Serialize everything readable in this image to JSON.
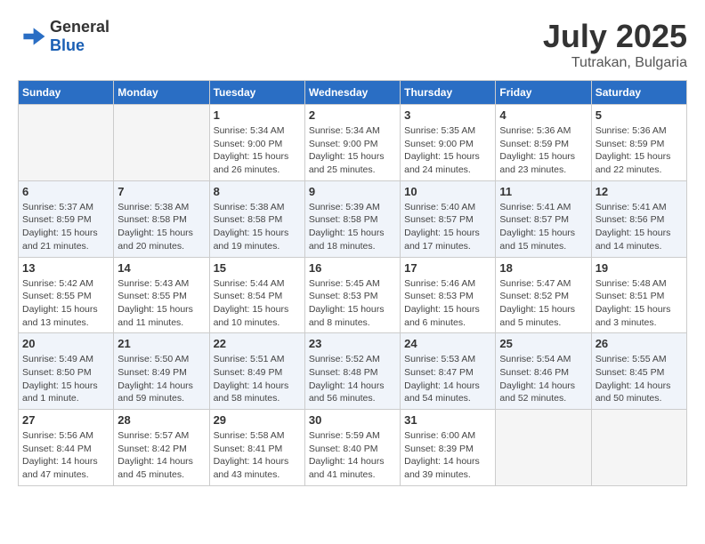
{
  "header": {
    "logo_general": "General",
    "logo_blue": "Blue",
    "month_year": "July 2025",
    "location": "Tutrakan, Bulgaria"
  },
  "weekdays": [
    "Sunday",
    "Monday",
    "Tuesday",
    "Wednesday",
    "Thursday",
    "Friday",
    "Saturday"
  ],
  "weeks": [
    [
      {
        "day": "",
        "info": ""
      },
      {
        "day": "",
        "info": ""
      },
      {
        "day": "1",
        "info": "Sunrise: 5:34 AM\nSunset: 9:00 PM\nDaylight: 15 hours\nand 26 minutes."
      },
      {
        "day": "2",
        "info": "Sunrise: 5:34 AM\nSunset: 9:00 PM\nDaylight: 15 hours\nand 25 minutes."
      },
      {
        "day": "3",
        "info": "Sunrise: 5:35 AM\nSunset: 9:00 PM\nDaylight: 15 hours\nand 24 minutes."
      },
      {
        "day": "4",
        "info": "Sunrise: 5:36 AM\nSunset: 8:59 PM\nDaylight: 15 hours\nand 23 minutes."
      },
      {
        "day": "5",
        "info": "Sunrise: 5:36 AM\nSunset: 8:59 PM\nDaylight: 15 hours\nand 22 minutes."
      }
    ],
    [
      {
        "day": "6",
        "info": "Sunrise: 5:37 AM\nSunset: 8:59 PM\nDaylight: 15 hours\nand 21 minutes."
      },
      {
        "day": "7",
        "info": "Sunrise: 5:38 AM\nSunset: 8:58 PM\nDaylight: 15 hours\nand 20 minutes."
      },
      {
        "day": "8",
        "info": "Sunrise: 5:38 AM\nSunset: 8:58 PM\nDaylight: 15 hours\nand 19 minutes."
      },
      {
        "day": "9",
        "info": "Sunrise: 5:39 AM\nSunset: 8:58 PM\nDaylight: 15 hours\nand 18 minutes."
      },
      {
        "day": "10",
        "info": "Sunrise: 5:40 AM\nSunset: 8:57 PM\nDaylight: 15 hours\nand 17 minutes."
      },
      {
        "day": "11",
        "info": "Sunrise: 5:41 AM\nSunset: 8:57 PM\nDaylight: 15 hours\nand 15 minutes."
      },
      {
        "day": "12",
        "info": "Sunrise: 5:41 AM\nSunset: 8:56 PM\nDaylight: 15 hours\nand 14 minutes."
      }
    ],
    [
      {
        "day": "13",
        "info": "Sunrise: 5:42 AM\nSunset: 8:55 PM\nDaylight: 15 hours\nand 13 minutes."
      },
      {
        "day": "14",
        "info": "Sunrise: 5:43 AM\nSunset: 8:55 PM\nDaylight: 15 hours\nand 11 minutes."
      },
      {
        "day": "15",
        "info": "Sunrise: 5:44 AM\nSunset: 8:54 PM\nDaylight: 15 hours\nand 10 minutes."
      },
      {
        "day": "16",
        "info": "Sunrise: 5:45 AM\nSunset: 8:53 PM\nDaylight: 15 hours\nand 8 minutes."
      },
      {
        "day": "17",
        "info": "Sunrise: 5:46 AM\nSunset: 8:53 PM\nDaylight: 15 hours\nand 6 minutes."
      },
      {
        "day": "18",
        "info": "Sunrise: 5:47 AM\nSunset: 8:52 PM\nDaylight: 15 hours\nand 5 minutes."
      },
      {
        "day": "19",
        "info": "Sunrise: 5:48 AM\nSunset: 8:51 PM\nDaylight: 15 hours\nand 3 minutes."
      }
    ],
    [
      {
        "day": "20",
        "info": "Sunrise: 5:49 AM\nSunset: 8:50 PM\nDaylight: 15 hours\nand 1 minute."
      },
      {
        "day": "21",
        "info": "Sunrise: 5:50 AM\nSunset: 8:49 PM\nDaylight: 14 hours\nand 59 minutes."
      },
      {
        "day": "22",
        "info": "Sunrise: 5:51 AM\nSunset: 8:49 PM\nDaylight: 14 hours\nand 58 minutes."
      },
      {
        "day": "23",
        "info": "Sunrise: 5:52 AM\nSunset: 8:48 PM\nDaylight: 14 hours\nand 56 minutes."
      },
      {
        "day": "24",
        "info": "Sunrise: 5:53 AM\nSunset: 8:47 PM\nDaylight: 14 hours\nand 54 minutes."
      },
      {
        "day": "25",
        "info": "Sunrise: 5:54 AM\nSunset: 8:46 PM\nDaylight: 14 hours\nand 52 minutes."
      },
      {
        "day": "26",
        "info": "Sunrise: 5:55 AM\nSunset: 8:45 PM\nDaylight: 14 hours\nand 50 minutes."
      }
    ],
    [
      {
        "day": "27",
        "info": "Sunrise: 5:56 AM\nSunset: 8:44 PM\nDaylight: 14 hours\nand 47 minutes."
      },
      {
        "day": "28",
        "info": "Sunrise: 5:57 AM\nSunset: 8:42 PM\nDaylight: 14 hours\nand 45 minutes."
      },
      {
        "day": "29",
        "info": "Sunrise: 5:58 AM\nSunset: 8:41 PM\nDaylight: 14 hours\nand 43 minutes."
      },
      {
        "day": "30",
        "info": "Sunrise: 5:59 AM\nSunset: 8:40 PM\nDaylight: 14 hours\nand 41 minutes."
      },
      {
        "day": "31",
        "info": "Sunrise: 6:00 AM\nSunset: 8:39 PM\nDaylight: 14 hours\nand 39 minutes."
      },
      {
        "day": "",
        "info": ""
      },
      {
        "day": "",
        "info": ""
      }
    ]
  ]
}
